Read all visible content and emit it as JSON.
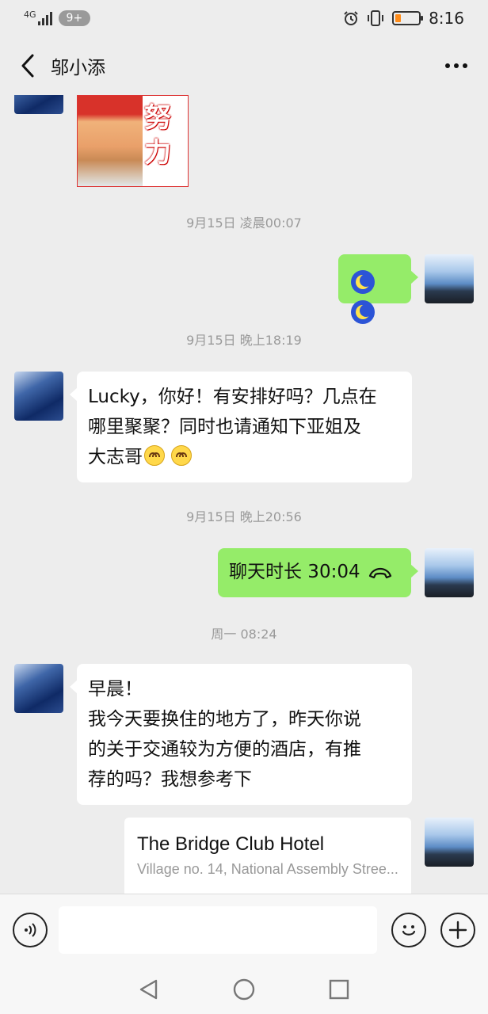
{
  "status_bar": {
    "network": "4G",
    "notification_badge": "9+",
    "time": "8:16",
    "battery_level": 0.25,
    "icons": [
      "signal-icon",
      "alarm-icon",
      "vibrate-icon",
      "battery-icon"
    ]
  },
  "header": {
    "title": "邬小添",
    "back_icon": "chevron-left-icon",
    "more_icon": "more-dots-icon"
  },
  "messages": [
    {
      "type": "sticker",
      "side": "in",
      "sticker_text": "努力"
    },
    {
      "type": "timestamp",
      "text": "9月15日 凌晨00:07"
    },
    {
      "type": "emoji",
      "side": "out",
      "emoji": [
        "moon-emoji",
        "moon-emoji"
      ]
    },
    {
      "type": "timestamp",
      "text": "9月15日 晚上18:19"
    },
    {
      "type": "text",
      "side": "in",
      "lines": [
        "Lucky，你好！有安排好吗？几点在",
        "哪里聚聚？同时也请通知下亚姐及",
        "大志哥"
      ],
      "trailing_emoji": [
        "smile-emoji",
        "smile-emoji"
      ]
    },
    {
      "type": "timestamp",
      "text": "9月15日 晚上20:56"
    },
    {
      "type": "call",
      "side": "out",
      "text": "聊天时长 30:04"
    },
    {
      "type": "timestamp",
      "text": "周一 08:24"
    },
    {
      "type": "text",
      "side": "in",
      "lines": [
        "早晨！",
        "我今天要换住的地方了，昨天你说",
        "的关于交通较为方便的酒店，有推",
        "荐的吗？我想参考下"
      ]
    },
    {
      "type": "link",
      "side": "out",
      "title": "The Bridge Club Hotel",
      "subtitle": "Village no. 14, National Assembly Stree..."
    }
  ],
  "input_bar": {
    "voice_icon": "voice-icon",
    "text_value": "",
    "emoji_icon": "emoji-icon",
    "plus_icon": "plus-icon"
  },
  "nav_bar": {
    "icons": [
      "back-triangle-icon",
      "home-circle-icon",
      "recents-square-icon"
    ]
  },
  "colors": {
    "background": "#ededed",
    "out_bubble": "#95ec69",
    "in_bubble": "#ffffff",
    "timestamp": "#9a9a9a"
  }
}
